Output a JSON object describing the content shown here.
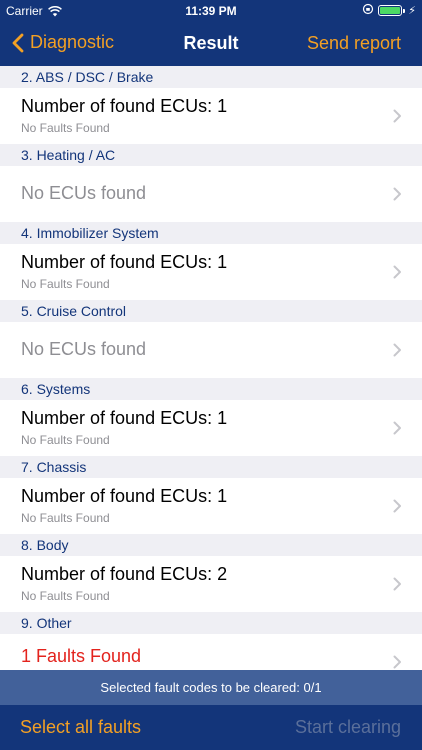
{
  "status_bar": {
    "carrier": "Carrier",
    "time": "11:39 PM",
    "charge_symbol": "⚡"
  },
  "nav": {
    "back_label": "Diagnostic",
    "title": "Result",
    "action_label": "Send report"
  },
  "sections": [
    {
      "header": "2. ABS / DSC / Brake",
      "cell": {
        "title": "Number of found ECUs:  1",
        "subtitle": "No Faults Found"
      }
    },
    {
      "header": "3. Heating / AC",
      "cell": {
        "title": "No ECUs found"
      }
    },
    {
      "header": "4. Immobilizer System",
      "cell": {
        "title": "Number of found ECUs:  1",
        "subtitle": "No Faults Found"
      }
    },
    {
      "header": "5. Cruise Control",
      "cell": {
        "title": "No ECUs found"
      }
    },
    {
      "header": "6. Systems",
      "cell": {
        "title": "Number of found ECUs:  1",
        "subtitle": "No Faults Found"
      }
    },
    {
      "header": "7. Chassis",
      "cell": {
        "title": "Number of found ECUs:  1",
        "subtitle": "No Faults Found"
      }
    },
    {
      "header": "8. Body",
      "cell": {
        "title": "Number of found ECUs:  2",
        "subtitle": "No Faults Found"
      }
    },
    {
      "header": "9. Other",
      "cell": {
        "title": "1 Faults Found"
      }
    }
  ],
  "footer": {
    "info": "Selected fault codes to be cleared:  0/1",
    "select_all_label": "Select all faults",
    "start_label": "Start clearing"
  },
  "colors": {
    "nav_bg": "#13357a",
    "accent": "#f3a024",
    "section_text": "#13357a",
    "fault_red": "#e3231d",
    "info_bar_bg": "#42619a",
    "disabled": "#5a6f9a"
  },
  "icons": {
    "back": "chevron-left-icon",
    "row": "chevron-right-icon",
    "wifi": "wifi-icon",
    "battery": "battery-icon"
  }
}
